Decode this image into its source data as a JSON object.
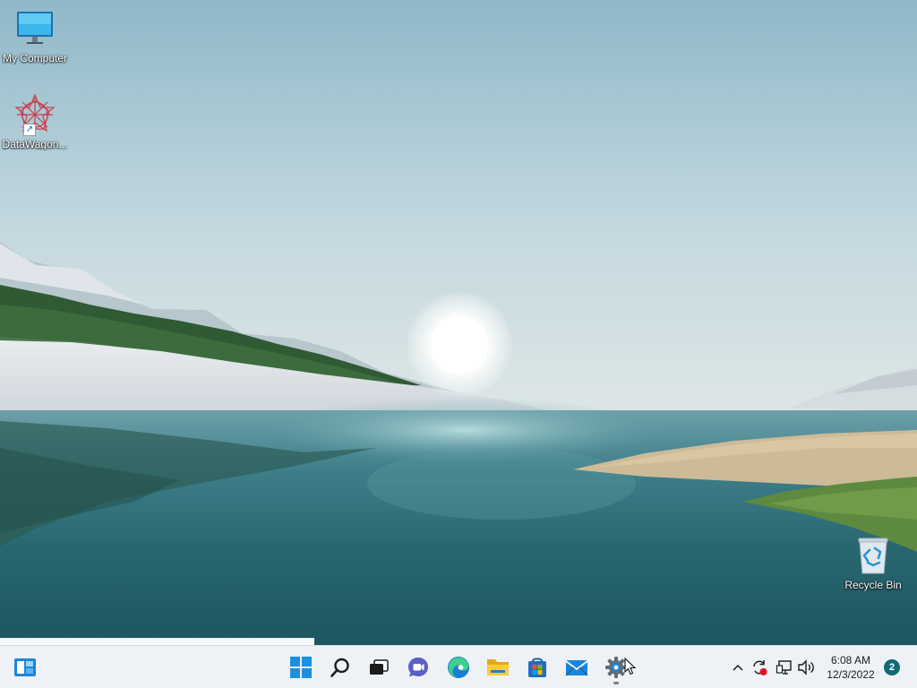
{
  "desktop": {
    "icons": [
      {
        "label": "My Computer",
        "icon": "monitor-icon"
      },
      {
        "label": "DataWagon...",
        "icon": "datawagon-app-icon"
      },
      {
        "label": "Recycle Bin",
        "icon": "recycle-bin-icon"
      }
    ]
  },
  "taskbar": {
    "pinned": [
      {
        "name": "Widgets",
        "icon": "widgets-icon"
      },
      {
        "name": "Start",
        "icon": "windows-logo-icon"
      },
      {
        "name": "Search",
        "icon": "search-icon"
      },
      {
        "name": "Task View",
        "icon": "task-view-icon"
      },
      {
        "name": "Chat",
        "icon": "teams-chat-icon"
      },
      {
        "name": "Microsoft Edge",
        "icon": "edge-icon"
      },
      {
        "name": "File Explorer",
        "icon": "folder-icon"
      },
      {
        "name": "Microsoft Store",
        "icon": "store-icon"
      },
      {
        "name": "Mail",
        "icon": "mail-icon"
      },
      {
        "name": "Settings",
        "icon": "gear-icon",
        "running": true
      }
    ],
    "tray": {
      "icons": [
        "chevron-up-icon",
        "sync-icon",
        "network-icon",
        "volume-icon"
      ],
      "clock_time": "6:08 AM",
      "clock_date": "12/3/2022",
      "notification_count": "2"
    }
  },
  "colors": {
    "taskbar_bg": "#eef1f5",
    "accent": "#0078d4",
    "badge": "#0f6a74"
  }
}
